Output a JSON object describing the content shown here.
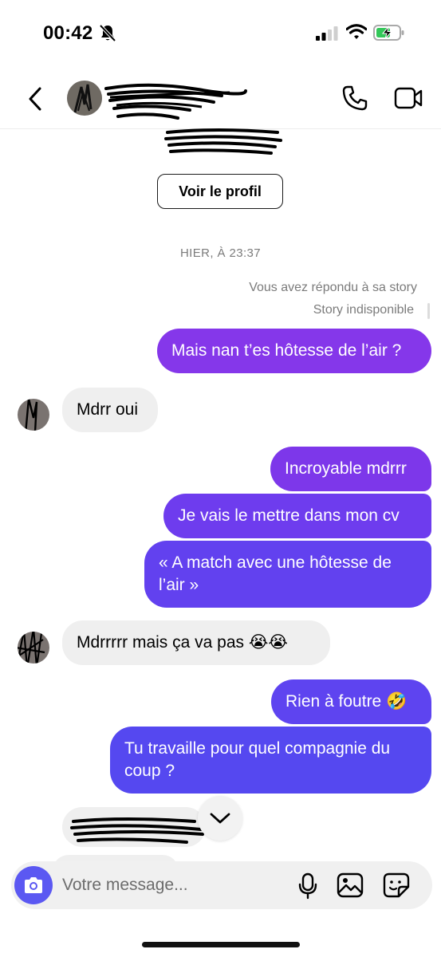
{
  "status_bar": {
    "time": "00:42"
  },
  "header": {
    "name": ""
  },
  "profile_button": "Voir le profil",
  "date_separator": "HIER, À 23:37",
  "story_reply_note": "Vous avez répondu à sa story",
  "story_unavailable": "Story indisponible",
  "messages": [
    {
      "from": "me",
      "text": "Mais nan t’es hôtesse de l’air ?"
    },
    {
      "from": "them",
      "text": "Mdrr oui"
    },
    {
      "from": "me",
      "text": "Incroyable mdrrr"
    },
    {
      "from": "me",
      "text": "Je vais le mettre dans mon cv"
    },
    {
      "from": "me",
      "text": "« A match avec une hôtesse de l’air »"
    },
    {
      "from": "them",
      "text": "Mdrrrrr mais ça va pas 😭😭"
    },
    {
      "from": "me",
      "text": "Rien à foutre 🤣"
    },
    {
      "from": "me",
      "text": "Tu travaille pour quel compagnie du coup ?"
    }
  ],
  "composer": {
    "placeholder": "Votre message..."
  },
  "colors": {
    "accent": "#5b58f2",
    "bubble_top": "#8a2be8",
    "bubble_bottom": "#5448f0",
    "received_bg": "#efefef"
  },
  "icons": [
    "back-icon",
    "phone-icon",
    "video-icon",
    "camera-icon",
    "mic-icon",
    "gallery-icon",
    "sticker-icon",
    "chevron-down-icon",
    "bell-off-icon",
    "signal-icon",
    "wifi-icon",
    "battery-charging-icon"
  ]
}
